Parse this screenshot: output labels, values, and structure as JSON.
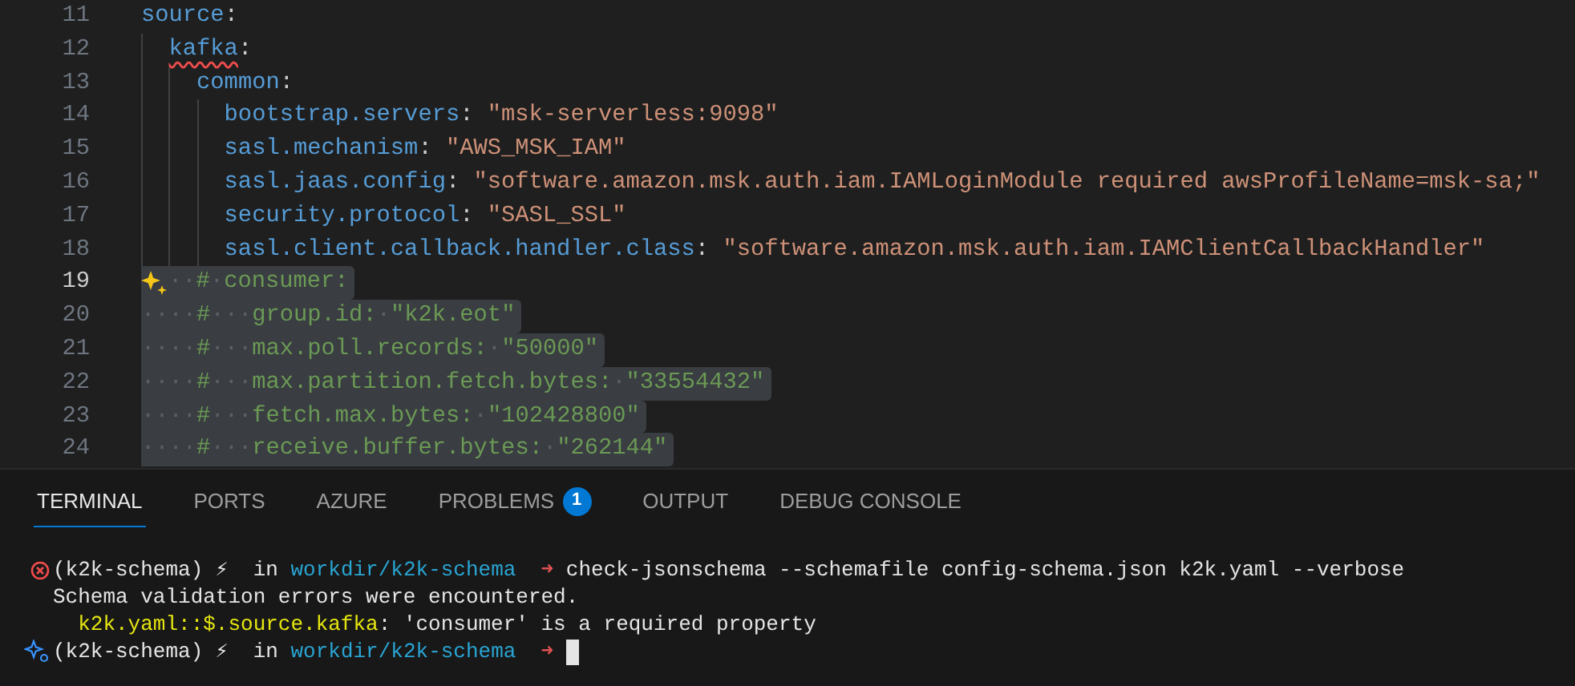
{
  "editor": {
    "lines": [
      {
        "number": "11",
        "current": false,
        "selected": false,
        "segments": [
          {
            "kind": "key",
            "text": "source"
          },
          {
            "kind": "punct",
            "text": ":"
          }
        ],
        "children": [
          {
            "number": "12",
            "current": false,
            "selected": false,
            "segments": [
              {
                "kind": "key",
                "text": "kafka",
                "error": true
              },
              {
                "kind": "punct",
                "text": ":"
              }
            ],
            "children": [
              {
                "number": "13",
                "current": false,
                "selected": false,
                "segments": [
                  {
                    "kind": "key",
                    "text": "common"
                  },
                  {
                    "kind": "punct",
                    "text": ":"
                  }
                ],
                "children": [
                  {
                    "number": "14",
                    "current": false,
                    "selected": false,
                    "segments": [
                      {
                        "kind": "key",
                        "text": "bootstrap.servers"
                      },
                      {
                        "kind": "punct",
                        "text": ": "
                      },
                      {
                        "kind": "string",
                        "text": "\"msk-serverless:9098\""
                      }
                    ]
                  },
                  {
                    "number": "15",
                    "current": false,
                    "selected": false,
                    "segments": [
                      {
                        "kind": "key",
                        "text": "sasl.mechanism"
                      },
                      {
                        "kind": "punct",
                        "text": ": "
                      },
                      {
                        "kind": "string",
                        "text": "\"AWS_MSK_IAM\""
                      }
                    ]
                  },
                  {
                    "number": "16",
                    "current": false,
                    "selected": false,
                    "segments": [
                      {
                        "kind": "key",
                        "text": "sasl.jaas.config"
                      },
                      {
                        "kind": "punct",
                        "text": ": "
                      },
                      {
                        "kind": "string",
                        "text": "\"software.amazon.msk.auth.iam.IAMLoginModule required awsProfileName=msk-sa;\""
                      }
                    ]
                  },
                  {
                    "number": "17",
                    "current": false,
                    "selected": false,
                    "segments": [
                      {
                        "kind": "key",
                        "text": "security.protocol"
                      },
                      {
                        "kind": "punct",
                        "text": ": "
                      },
                      {
                        "kind": "string",
                        "text": "\"SASL_SSL\""
                      }
                    ]
                  },
                  {
                    "number": "18",
                    "current": false,
                    "selected": false,
                    "segments": [
                      {
                        "kind": "key",
                        "text": "sasl.client.callback.handler.class"
                      },
                      {
                        "kind": "punct",
                        "text": ": "
                      },
                      {
                        "kind": "string",
                        "text": "\"software.amazon.msk.auth.iam.IAMClientCallbackHandler\""
                      }
                    ]
                  }
                ]
              }
            ]
          }
        ]
      },
      {
        "number": "19",
        "current": true,
        "selected": true,
        "ai_hint": true,
        "segments": [
          {
            "kind": "whitespace",
            "text": "··"
          },
          {
            "kind": "comment",
            "text": "#"
          },
          {
            "kind": "whitespace",
            "text": "·"
          },
          {
            "kind": "comment",
            "text": "consumer:"
          }
        ]
      },
      {
        "number": "20",
        "current": false,
        "selected": true,
        "segments": [
          {
            "kind": "whitespace",
            "text": "····"
          },
          {
            "kind": "comment",
            "text": "#"
          },
          {
            "kind": "whitespace",
            "text": "···"
          },
          {
            "kind": "comment",
            "text": "group.id:"
          },
          {
            "kind": "whitespace",
            "text": "·"
          },
          {
            "kind": "comment",
            "text": "\"k2k.eot\""
          }
        ]
      },
      {
        "number": "21",
        "current": false,
        "selected": true,
        "segments": [
          {
            "kind": "whitespace",
            "text": "····"
          },
          {
            "kind": "comment",
            "text": "#"
          },
          {
            "kind": "whitespace",
            "text": "···"
          },
          {
            "kind": "comment",
            "text": "max.poll.records:"
          },
          {
            "kind": "whitespace",
            "text": "·"
          },
          {
            "kind": "comment",
            "text": "\"50000\""
          }
        ]
      },
      {
        "number": "22",
        "current": false,
        "selected": true,
        "segments": [
          {
            "kind": "whitespace",
            "text": "····"
          },
          {
            "kind": "comment",
            "text": "#"
          },
          {
            "kind": "whitespace",
            "text": "···"
          },
          {
            "kind": "comment",
            "text": "max.partition.fetch.bytes:"
          },
          {
            "kind": "whitespace",
            "text": "·"
          },
          {
            "kind": "comment",
            "text": "\"33554432\""
          }
        ]
      },
      {
        "number": "23",
        "current": false,
        "selected": true,
        "segments": [
          {
            "kind": "whitespace",
            "text": "····"
          },
          {
            "kind": "comment",
            "text": "#"
          },
          {
            "kind": "whitespace",
            "text": "···"
          },
          {
            "kind": "comment",
            "text": "fetch.max.bytes:"
          },
          {
            "kind": "whitespace",
            "text": "·"
          },
          {
            "kind": "comment",
            "text": "\"102428800\""
          }
        ]
      },
      {
        "number": "24",
        "current": false,
        "selected": true,
        "segments": [
          {
            "kind": "whitespace",
            "text": "····"
          },
          {
            "kind": "comment",
            "text": "#"
          },
          {
            "kind": "whitespace",
            "text": "···"
          },
          {
            "kind": "comment",
            "text": "receive.buffer.bytes:"
          },
          {
            "kind": "whitespace",
            "text": "·"
          },
          {
            "kind": "comment",
            "text": "\"262144\""
          }
        ]
      }
    ]
  },
  "panel": {
    "tabs": [
      {
        "label": "TERMINAL",
        "selected": true
      },
      {
        "label": "PORTS",
        "selected": false
      },
      {
        "label": "AZURE",
        "selected": false
      },
      {
        "label": "PROBLEMS",
        "selected": false,
        "badge": "1"
      },
      {
        "label": "OUTPUT",
        "selected": false
      },
      {
        "label": "DEBUG CONSOLE",
        "selected": false
      }
    ],
    "terminal": {
      "lines": [
        {
          "kind": "failed_command",
          "segments": [
            {
              "kind": "prompt",
              "text": "(k2k-schema) ⚡  in "
            },
            {
              "kind": "path",
              "text": "workdir/k2k-schema"
            },
            {
              "kind": "arrow",
              "text": "  ➜ "
            },
            {
              "kind": "plain",
              "text": "check-jsonschema --schemafile config-schema.json k2k.yaml --verbose"
            }
          ]
        },
        {
          "kind": "output",
          "segments": [
            {
              "kind": "plain",
              "text": "Schema validation errors were encountered."
            }
          ]
        },
        {
          "kind": "output",
          "segments": [
            {
              "kind": "highlight",
              "text": "  k2k.yaml::$.source.kafka"
            },
            {
              "kind": "plain",
              "text": ": 'consumer' is a required property"
            }
          ]
        },
        {
          "kind": "prompt",
          "cursor": true,
          "segments": [
            {
              "kind": "prompt",
              "text": "(k2k-schema) ⚡  in "
            },
            {
              "kind": "path",
              "text": "workdir/k2k-schema"
            },
            {
              "kind": "arrow",
              "text": "  ➜ "
            }
          ]
        }
      ]
    }
  }
}
